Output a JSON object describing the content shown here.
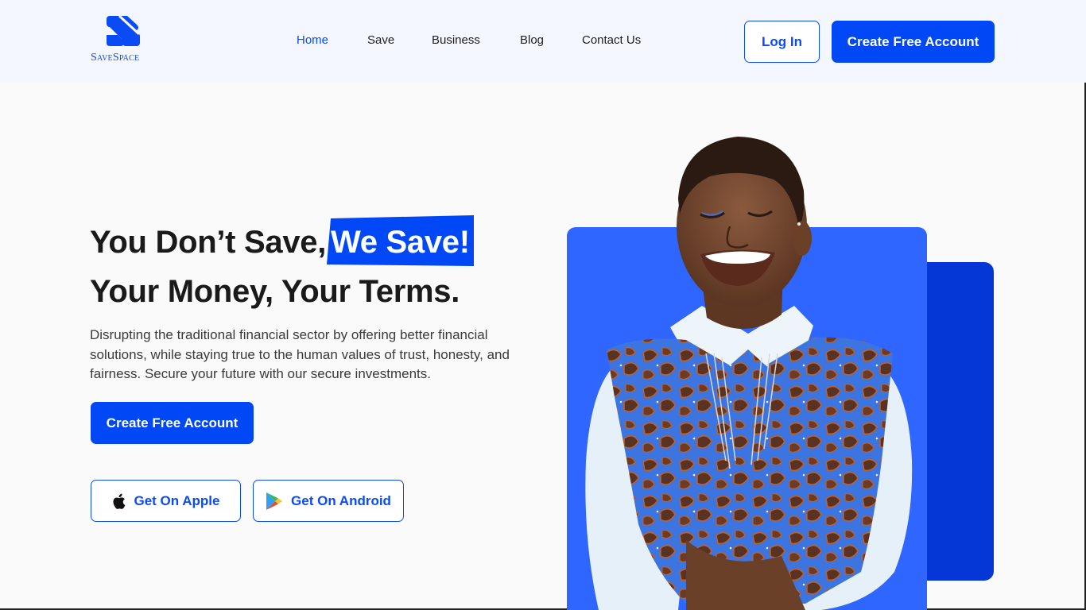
{
  "brand": {
    "name": "SaveSpace",
    "logo_icon": "savespace-s-logo-icon",
    "accent_color": "#0047F5",
    "panel_color": "#2F66FF",
    "panel_dark_color": "#0437D6"
  },
  "nav": {
    "items": [
      {
        "label": "Home",
        "active": true
      },
      {
        "label": "Save",
        "active": false
      },
      {
        "label": "Business",
        "active": false
      },
      {
        "label": "Blog",
        "active": false
      },
      {
        "label": "Contact Us",
        "active": false
      }
    ]
  },
  "header_actions": {
    "login_label": "Log In",
    "signup_label": "Create Free Account"
  },
  "hero": {
    "title_line1_prefix": "You Don’t Save,",
    "title_line1_highlight": "We Save!",
    "title_line2": "Your Money, Your Terms.",
    "description": "Disrupting the traditional financial sector by offering better financial solutions, while staying true to the human values of trust, honesty, and fairness. Secure your future with our secure investments.",
    "cta_label": "Create Free Account",
    "apple_button": {
      "label": "Get On Apple",
      "icon": "apple-icon"
    },
    "android_button": {
      "label": "Get On Android",
      "icon": "google-play-icon"
    },
    "image_alt": "Smiling woman in white shirt and blue patterned top"
  }
}
